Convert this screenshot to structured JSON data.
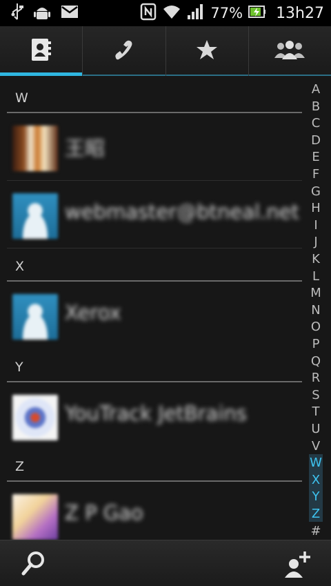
{
  "status_bar": {
    "icons": [
      "usb-icon",
      "android-icon",
      "gmail-icon",
      "nfc-icon",
      "wifi-icon",
      "signal-icon",
      "battery-charging-icon"
    ],
    "battery": "77%",
    "time": "13h27"
  },
  "tabs": [
    {
      "name": "contacts",
      "icon": "contacts-book-icon",
      "active": true
    },
    {
      "name": "phone",
      "icon": "phone-handset-icon",
      "active": false
    },
    {
      "name": "favorites",
      "icon": "star-icon",
      "active": false
    },
    {
      "name": "groups",
      "icon": "groups-icon",
      "active": false
    }
  ],
  "list": {
    "sections": [
      {
        "letter": "W",
        "contacts": [
          {
            "name": "王昭"
          },
          {
            "name": "webmaster@btneal.net"
          }
        ]
      },
      {
        "letter": "X",
        "contacts": [
          {
            "name": "Xerox"
          }
        ]
      },
      {
        "letter": "Y",
        "contacts": [
          {
            "name": "YouTrack JetBrains"
          }
        ]
      },
      {
        "letter": "Z",
        "contacts": [
          {
            "name": "Z P Gao"
          }
        ]
      }
    ]
  },
  "alpha_index": [
    "A",
    "B",
    "C",
    "D",
    "E",
    "F",
    "G",
    "H",
    "I",
    "J",
    "K",
    "L",
    "M",
    "N",
    "O",
    "P",
    "Q",
    "R",
    "S",
    "T",
    "U",
    "V",
    "W",
    "X",
    "Y",
    "Z",
    "#"
  ],
  "alpha_index_highlighted": [
    "W",
    "X",
    "Y",
    "Z"
  ],
  "colors": {
    "accent": "#2fb6e0",
    "background": "#171717"
  },
  "bottom_bar": {
    "left_icon": "search-icon",
    "right_icon": "add-contact-icon"
  }
}
